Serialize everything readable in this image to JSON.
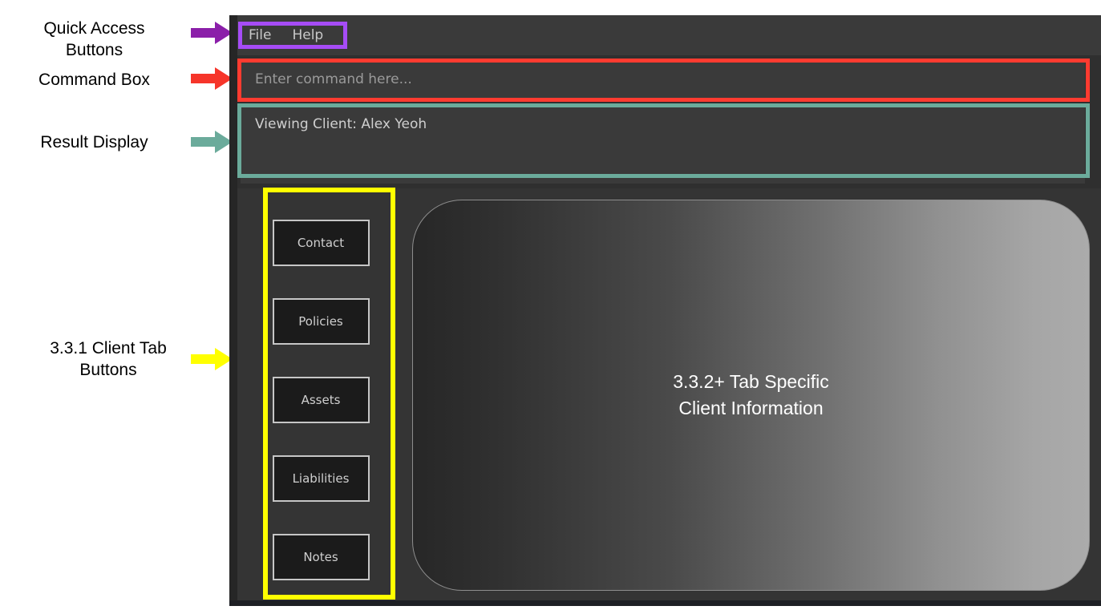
{
  "annotations": [
    {
      "id": "quick-access",
      "label": "Quick Access\nButtons",
      "color": "#8b1fa9",
      "arrow": "arrow-right-icon"
    },
    {
      "id": "command-box",
      "label": "Command Box",
      "color": "#f6352a",
      "arrow": "arrow-right-icon"
    },
    {
      "id": "result-display",
      "label": "Result Display",
      "color": "#6bab9b",
      "arrow": "arrow-right-icon"
    },
    {
      "id": "client-tabs",
      "label": "3.3.1 Client Tab\nButtons",
      "color": "#ffff00",
      "arrow": "arrow-right-icon"
    }
  ],
  "highlight_colors": {
    "quick_access": "#a64cf6",
    "command_box": "#ff3b30",
    "result_display": "#6bab9b",
    "client_tabs": "#ffff00"
  },
  "window": {
    "menu_bar": {
      "items": [
        {
          "label": "File"
        },
        {
          "label": "Help"
        }
      ]
    },
    "command_box": {
      "value": "",
      "placeholder": "Enter command here..."
    },
    "result_display": {
      "text": "Viewing Client: Alex Yeoh"
    },
    "client_tabs": [
      {
        "label": "Contact"
      },
      {
        "label": "Policies"
      },
      {
        "label": "Assets"
      },
      {
        "label": "Liabilities"
      },
      {
        "label": "Notes"
      }
    ],
    "content_panel": {
      "placeholder": "3.3.2+ Tab Specific\nClient Information"
    }
  }
}
